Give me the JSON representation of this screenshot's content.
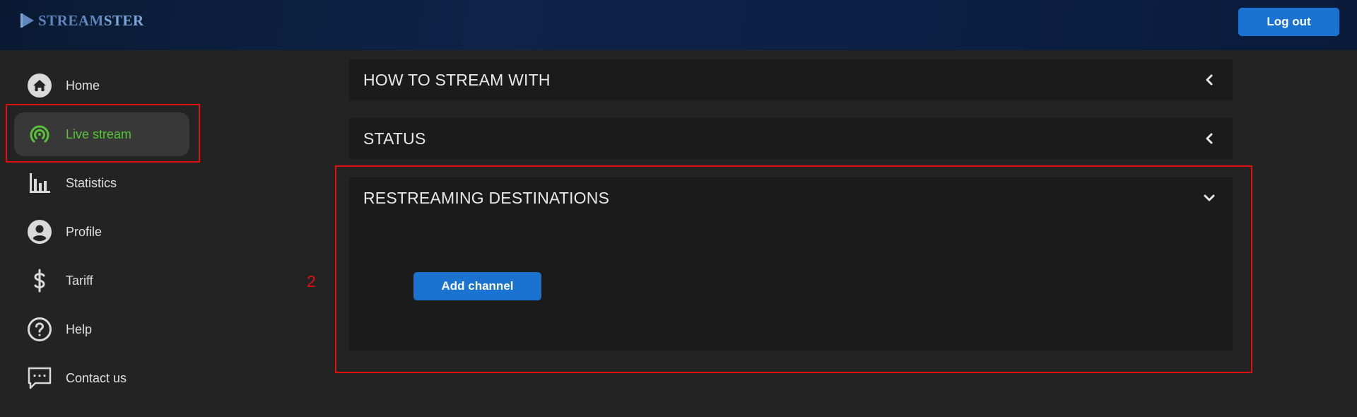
{
  "header": {
    "logo_text_a": "STREAM",
    "logo_text_b": "STER",
    "logout_label": "Log out"
  },
  "sidebar": {
    "items": [
      {
        "label": "Home",
        "icon": "home-icon"
      },
      {
        "label": "Live stream",
        "icon": "broadcast-icon",
        "active": true
      },
      {
        "label": "Statistics",
        "icon": "bar-chart-icon"
      },
      {
        "label": "Profile",
        "icon": "user-circle-icon"
      },
      {
        "label": "Tariff",
        "icon": "dollar-icon"
      },
      {
        "label": "Help",
        "icon": "question-circle-icon"
      },
      {
        "label": "Contact us",
        "icon": "chat-icon"
      }
    ]
  },
  "annotation": {
    "step_number": "2"
  },
  "panels": [
    {
      "title": "HOW TO STREAM WITH",
      "expanded": false
    },
    {
      "title": "STATUS",
      "expanded": false
    },
    {
      "title": "RESTREAMING DESTINATIONS",
      "expanded": true,
      "button_label": "Add channel"
    }
  ],
  "colors": {
    "accent_blue": "#1a73d1",
    "active_green": "#59c23a",
    "highlight_red": "#e01010",
    "background": "#232323",
    "panel_bg": "#1b1b1b"
  }
}
